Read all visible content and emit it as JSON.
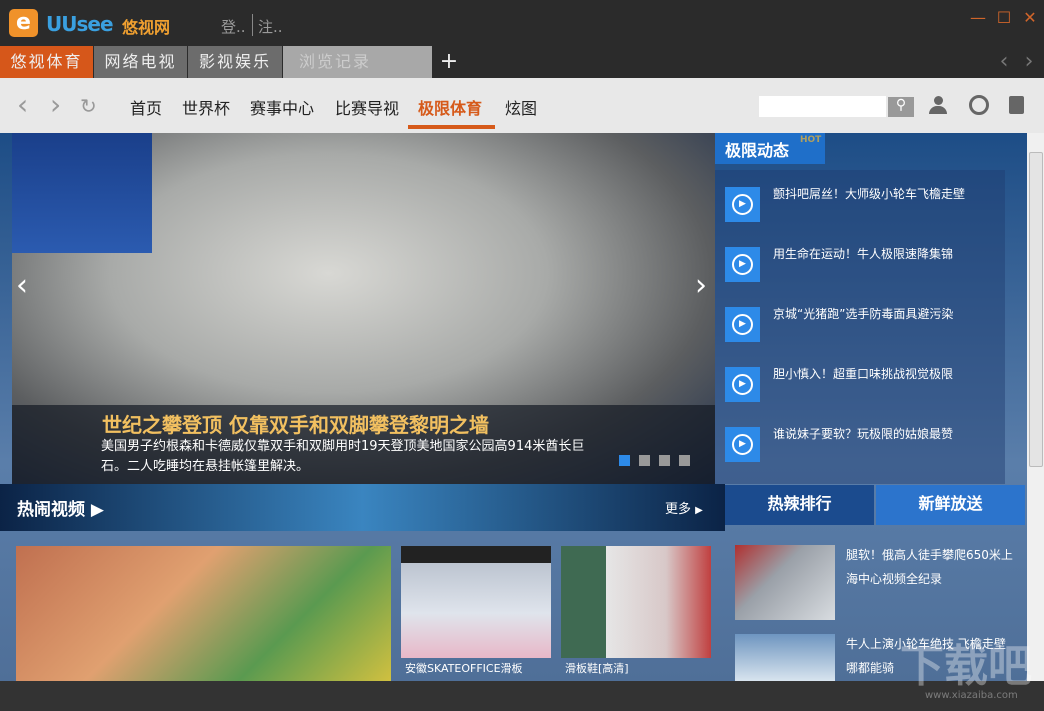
{
  "app": {
    "logo_icon": "e",
    "logo_text": "UUsee",
    "logo_cn": "悠视网",
    "login": "登..",
    "register": "注.."
  },
  "window": {
    "minimize": "—",
    "maximize": "☐",
    "close": "✕"
  },
  "tabs": [
    {
      "label": "悠视体育",
      "active": true
    },
    {
      "label": "网络电视"
    },
    {
      "label": "影视娱乐"
    },
    {
      "label": "浏览记录"
    }
  ],
  "tab_add": "+",
  "tab_prev": "‹",
  "tab_next": "›",
  "nav": {
    "back": "‹",
    "forward": "›",
    "refresh": "↻",
    "links": [
      "首页",
      "世界杯",
      "赛事中心",
      "比赛导视",
      "极限体育",
      "炫图"
    ],
    "active_index": 4,
    "search_placeholder": ""
  },
  "accent": "#d65a1a",
  "hero": {
    "title": "世纪之攀登顶  仅靠双手和双脚攀登黎明之墙",
    "description": "美国男子约根森和卡德威仅靠双手和双脚用时19天登顶美地国家公园高914米酋长巨石。二人吃睡均在悬挂帐篷里解决。",
    "slides": 4,
    "current_slide": 1
  },
  "dynamics": {
    "title": "极限动态",
    "badge": "HOT",
    "items": [
      "颤抖吧屌丝！大师级小轮车飞檐走壁",
      "用生命在运动！牛人极限速降集锦",
      "京城“光猪跑”选手防毒面具避污染",
      "胆小慎入！超重口味挑战视觉极限",
      "谁说妹子要软？玩极限的姑娘最赞"
    ]
  },
  "hot_videos": {
    "title": "热闹视频",
    "more": "更多",
    "items": [
      {
        "caption": ""
      },
      {
        "caption": "安徽SKATEOFFICE滑板"
      },
      {
        "caption": "滑板鞋[高清]"
      }
    ]
  },
  "ranking": {
    "tabs": [
      "热辣排行",
      "新鲜放送"
    ],
    "items": [
      "腿软！俄高人徒手攀爬650米上海中心视频全纪录",
      "牛人上演小轮车绝技 飞檐走壁哪都能骑"
    ]
  },
  "watermark": {
    "text": "下载吧",
    "url": "www.xiazaiba.com"
  }
}
